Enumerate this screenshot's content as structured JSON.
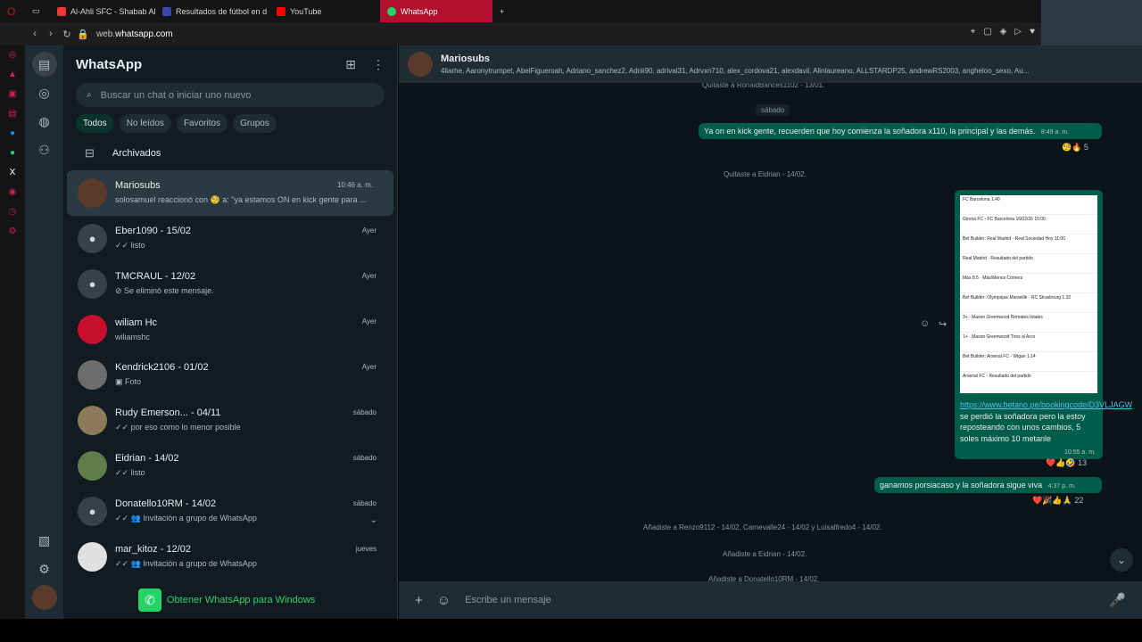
{
  "browser": {
    "tabs": [
      {
        "label": "Al-Ahli SFC - Shabab Al A",
        "color": "#e53935"
      },
      {
        "label": "Resultados de fútbol en d",
        "color": "#3949ab"
      },
      {
        "label": "YouTube",
        "color": "#ff0000"
      },
      {
        "label": "WhatsApp",
        "color": "#25d366"
      }
    ],
    "url_host": "web.",
    "url_rest": "whatsapp.com"
  },
  "sidebar": {
    "title": "WhatsApp",
    "search_placeholder": "Buscar un chat o iniciar uno nuevo",
    "filters": [
      "Todos",
      "No leídos",
      "Favoritos",
      "Grupos"
    ],
    "archived_label": "Archivados",
    "chats": [
      {
        "name": "Mariosubs",
        "time": "10:46 a. m.",
        "preview": "solosamuel reaccionó con 🧐 a: \"ya estamos ON en kick gente para ...",
        "avatar_color": "#5a3a2a"
      },
      {
        "name": "Eber1090 - 15/02",
        "time": "Ayer",
        "preview": "✓✓ listo",
        "avatar_color": ""
      },
      {
        "name": "TMCRAUL - 12/02",
        "time": "Ayer",
        "preview": "⊘ Se eliminó este mensaje.",
        "avatar_color": ""
      },
      {
        "name": "wiliam Hc",
        "time": "Ayer",
        "preview": "wiliamshc",
        "avatar_color": "#c8102e"
      },
      {
        "name": "Kendrick2106 - 01/02",
        "time": "Ayer",
        "preview": "▣ Foto",
        "avatar_color": "#6d6d6d"
      },
      {
        "name": "Rudy Emerson... - 04/11",
        "time": "sábado",
        "preview": "✓✓ por eso como lo menor posible",
        "avatar_color": "#8c7a5b"
      },
      {
        "name": "Eidrian - 14/02",
        "time": "sábado",
        "preview": "✓✓ listo",
        "avatar_color": "#5f7d4a"
      },
      {
        "name": "Donatello10RM - 14/02",
        "time": "sábado",
        "preview": "✓✓ 👥 Invitación a grupo de WhatsApp",
        "avatar_color": ""
      },
      {
        "name": "mar_kitoz - 12/02",
        "time": "jueves",
        "preview": "✓✓ 👥 Invitación a grupo de WhatsApp",
        "avatar_color": "#e0e0e0"
      }
    ],
    "get_windows": "Obtener WhatsApp para Windows"
  },
  "conversation": {
    "group_name": "Mariosubs",
    "members": "4liarhe, Aaronytrumpet, AbelFigueroah, Adriano_sanchez2, Adriii90, adrival31, Adrvxn710, alex_cordova21, alexdavil, Alinlaureano, ALLSTARDP25, andrewRS2003, angheloo_sexo, Au...",
    "sys_top": "Quitaste a RonaldBances1102 - 13/01.",
    "day_label": "sábado",
    "msg1": {
      "text": "Ya on en kick gente, recuerden que hoy comienza la soñadora x110, la principal y las demás.",
      "time": "8:49 a. m.",
      "reactions": "🧐🔥 5"
    },
    "sys_eidrian": "Quitaste a Eidrian - 14/02.",
    "msg2": {
      "link": "https://www.betano.pe/bookingcode/D3VLJAGW",
      "text": " se perdió la soñadora pero la estoy reposteando con unos cambios, 5 soles máximo 10 metanle",
      "time": "10:55 a. m.",
      "reactions": "❤️👍🤣 13"
    },
    "msg3": {
      "text": "ganamos porsiacaso y la soñadora sigue viva",
      "time": "4:37 p. m.",
      "reactions": "❤️🎉👍🙏 22"
    },
    "sys_added": "Añadiste a Renzo9112 - 14/02, Carnevalle24 - 14/02 y Luisalfredo4 - 14/02.",
    "sys_added2": "Añadiste a Eidrian - 14/02.",
    "sys_added3": "Añadiste a Donatello10RM - 14/02.",
    "bet_lines": [
      "FC Barcelona 1.40",
      "Girona FC - FC Barcelona 16/02/26 15:00",
      "Bet Builder: Real Madrid - Real Sociedad Hoy 11:00",
      "Real Madrid · Resultado del partido",
      "Más 8.5 · Más/Menos Córners",
      "Bet Builder: Olympique Marseille - RC Strasbourg 1.32",
      "3+ · Mason Greenwood Remates totales",
      "1+ · Mason Greenwood Tiros al Arco",
      "Bet Builder: Arsenal FC - Wigan 1.14",
      "Arsenal FC · Resultado del partido"
    ],
    "composer_placeholder": "Escribe un mensaje"
  }
}
